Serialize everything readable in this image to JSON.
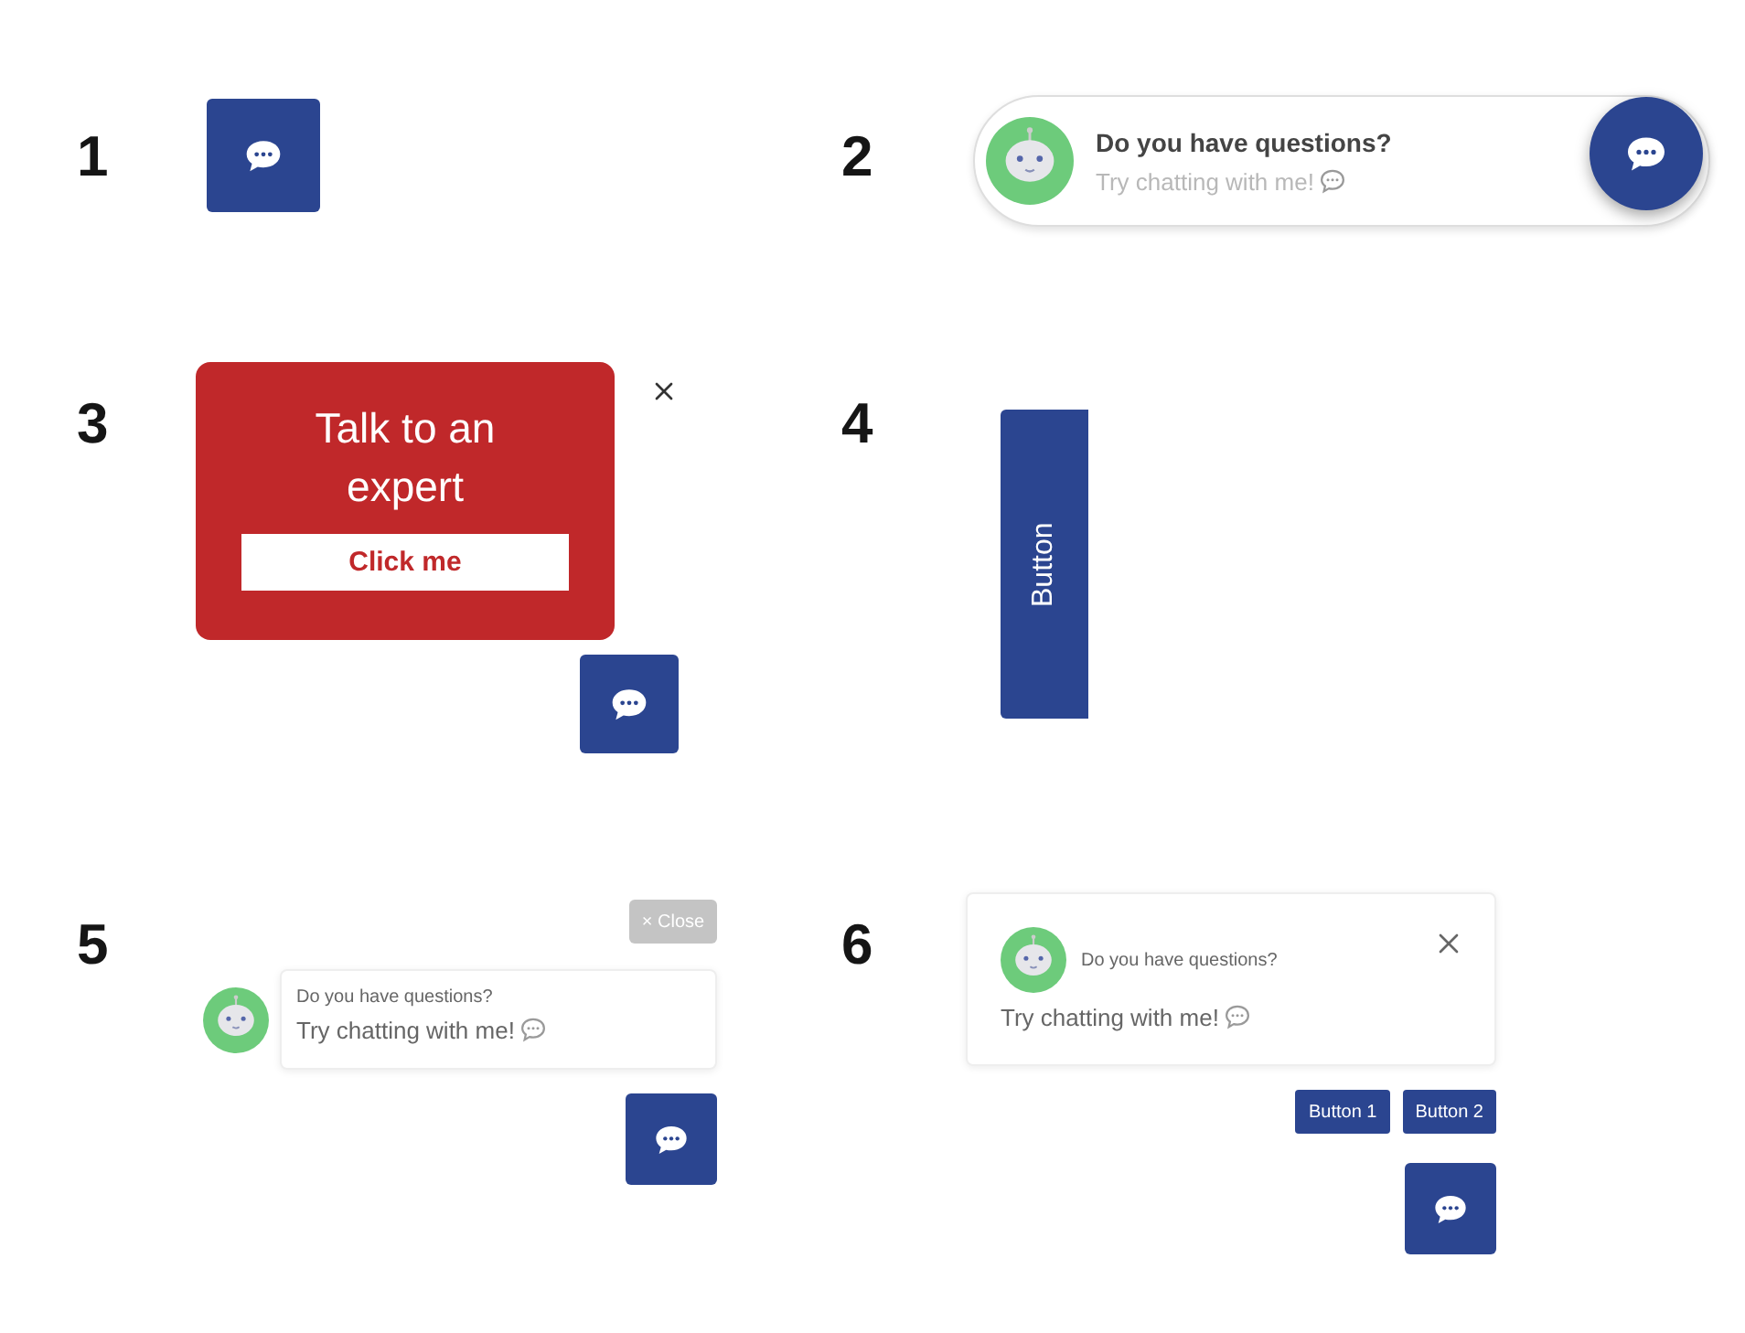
{
  "widgets": [
    {
      "kind": "square_button",
      "number": "1"
    },
    {
      "kind": "pill",
      "number": "2",
      "title": "Do you have questions?",
      "subtitle": "Try chatting with me!"
    },
    {
      "kind": "promo",
      "number": "3",
      "title": "Talk to an expert",
      "action": "Click me"
    },
    {
      "kind": "side_tab",
      "number": "4",
      "label": "Button"
    },
    {
      "kind": "bubble",
      "number": "5",
      "close": "× Close",
      "title": "Do you have questions?",
      "subtitle": "Try chatting with me!"
    },
    {
      "kind": "card",
      "number": "6",
      "title": "Do you have questions?",
      "subtitle": "Try chatting with me!",
      "buttons": [
        "Button 1",
        "Button 2"
      ]
    }
  ]
}
